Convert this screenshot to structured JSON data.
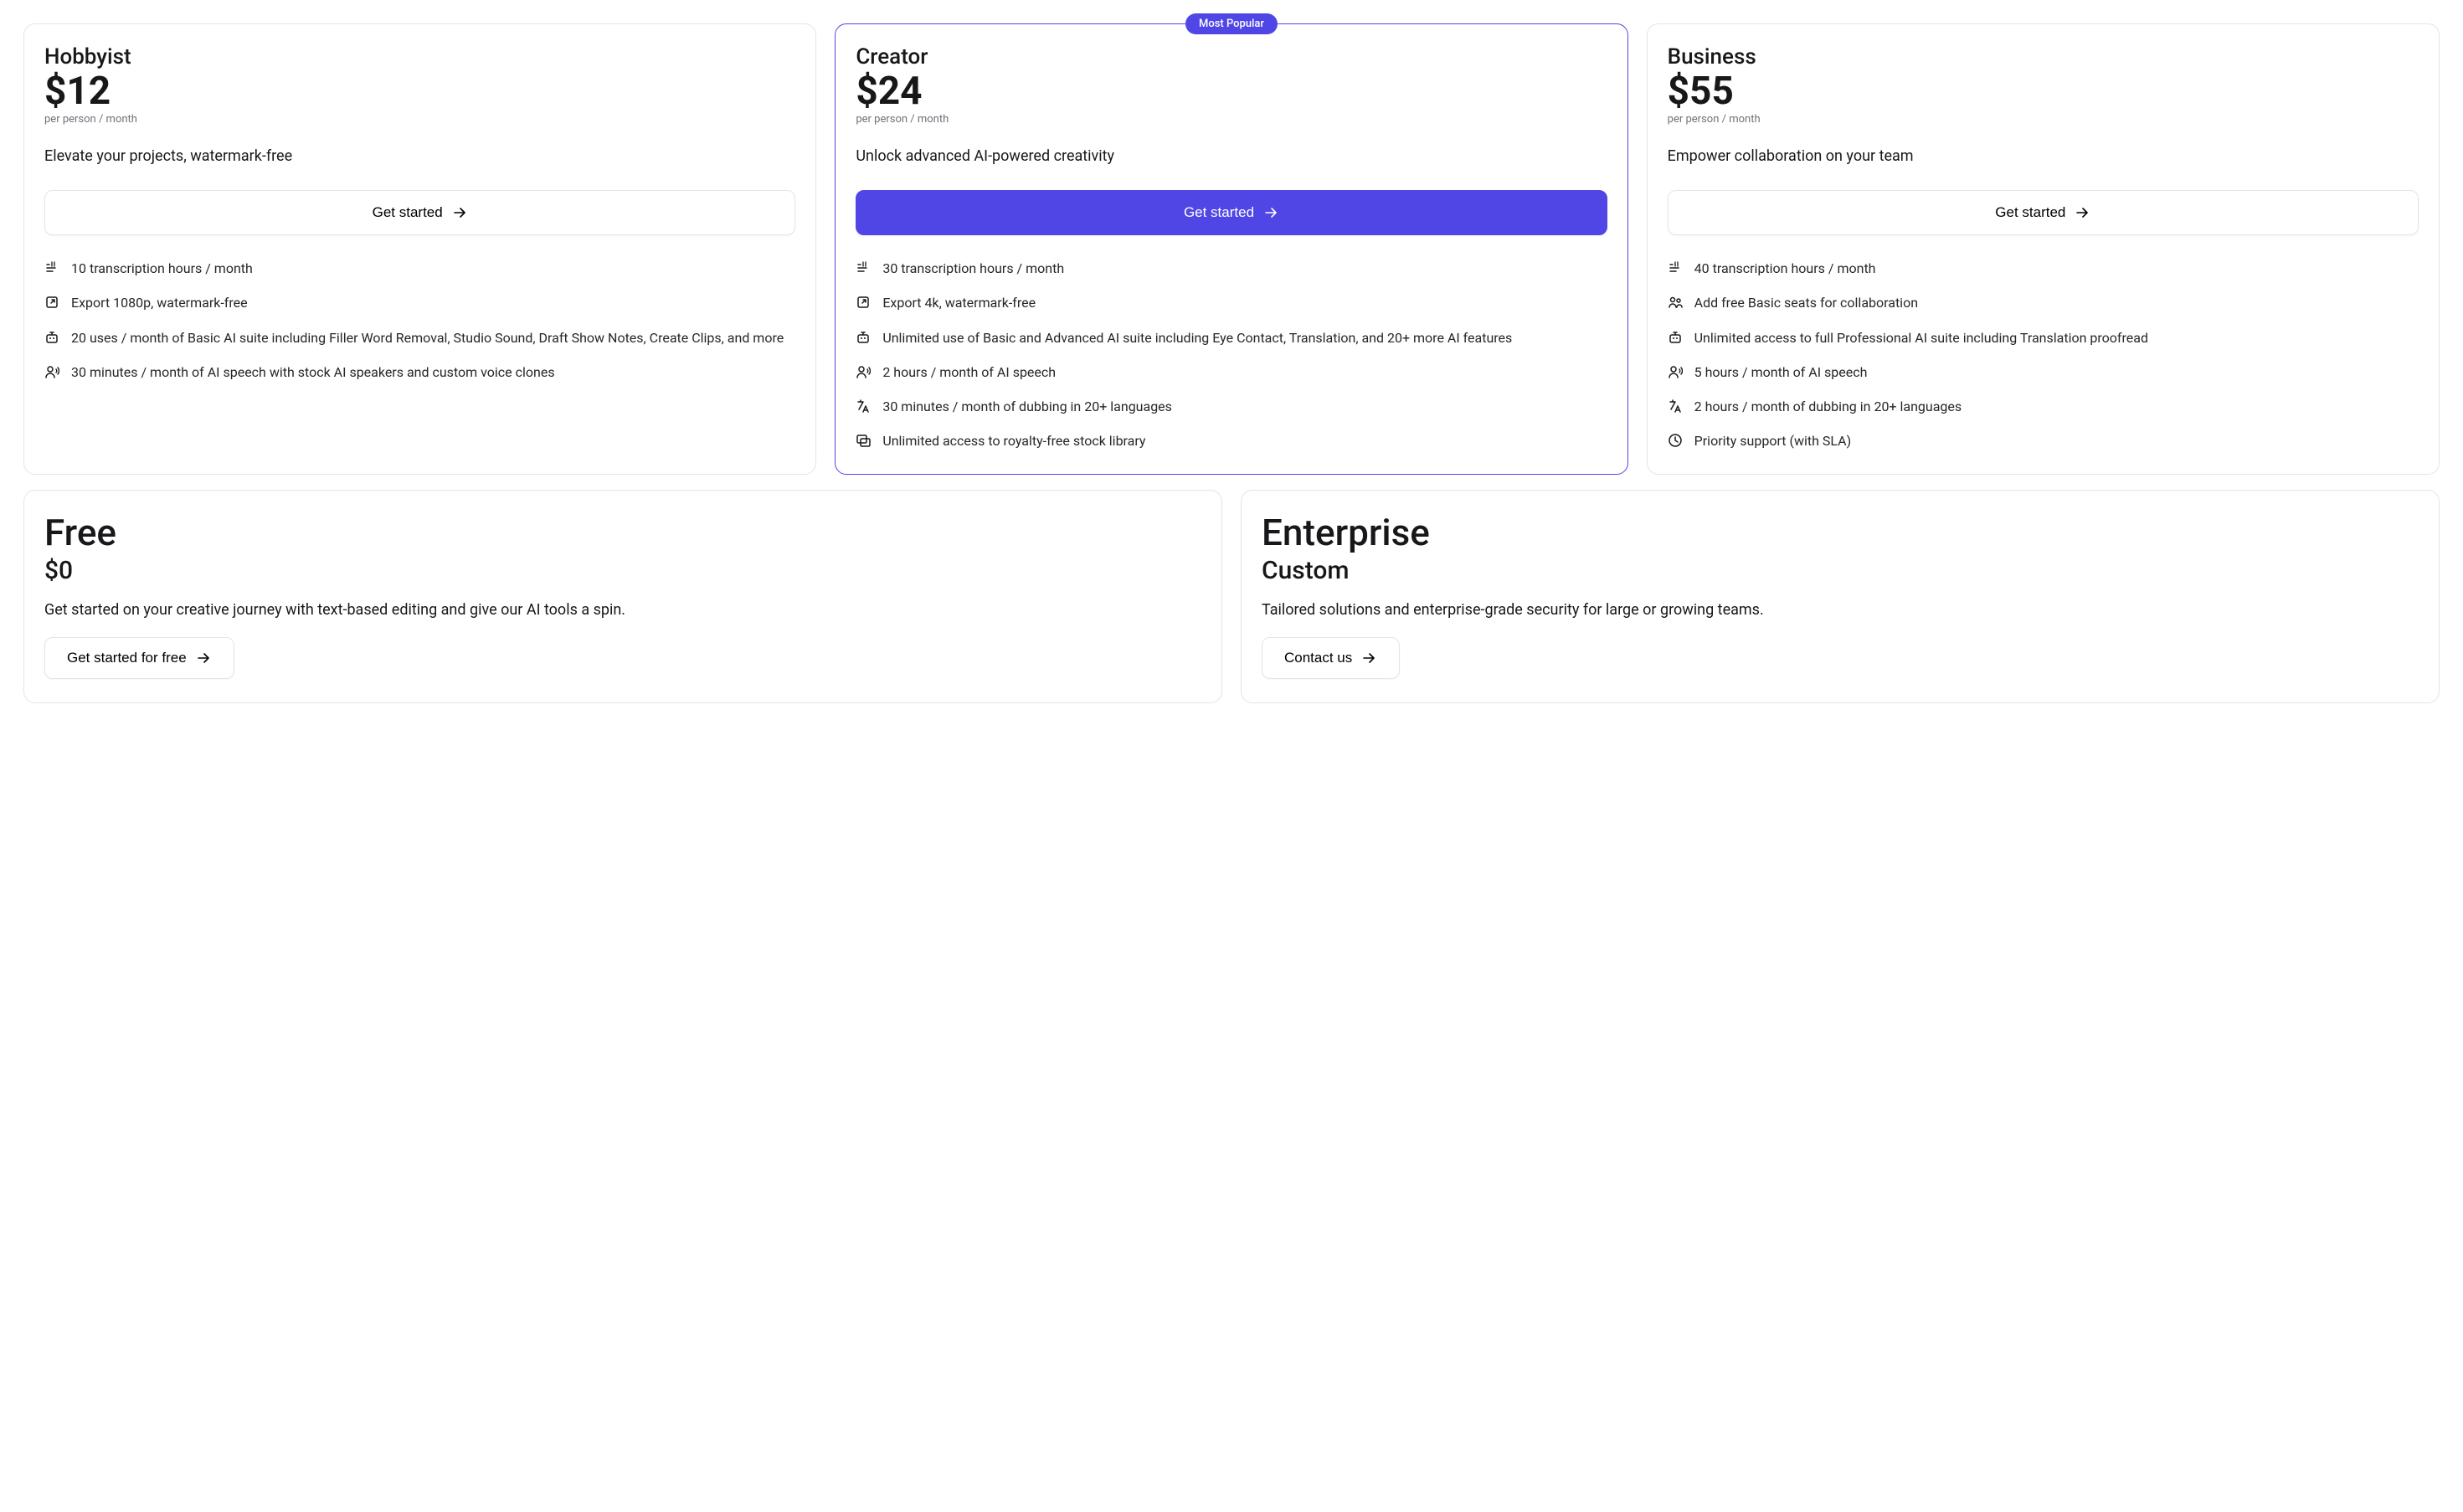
{
  "badge": "Most Popular",
  "plans": {
    "hobbyist": {
      "name": "Hobbyist",
      "price": "$12",
      "per": "per person / month",
      "tagline": "Elevate your projects, watermark-free",
      "cta": "Get started",
      "features": [
        {
          "icon": "transcription",
          "text": "10 transcription hours / month"
        },
        {
          "icon": "export",
          "text": "Export 1080p, watermark-free"
        },
        {
          "icon": "ai",
          "text": "20 uses / month of Basic AI suite including Filler Word Removal, Studio Sound, Draft Show Notes, Create Clips, and more"
        },
        {
          "icon": "speech",
          "text": "30 minutes / month of AI speech with stock AI speakers and custom voice clones"
        }
      ]
    },
    "creator": {
      "name": "Creator",
      "price": "$24",
      "per": "per person / month",
      "tagline": "Unlock advanced AI-powered creativity",
      "cta": "Get started",
      "features": [
        {
          "icon": "transcription",
          "text": "30 transcription hours / month"
        },
        {
          "icon": "export",
          "text": "Export 4k, watermark-free"
        },
        {
          "icon": "ai",
          "text": "Unlimited use of Basic and Advanced AI suite including Eye Contact, Translation, and 20+ more AI features"
        },
        {
          "icon": "speech",
          "text": "2 hours / month of AI speech"
        },
        {
          "icon": "dubbing",
          "text": "30 minutes / month of dubbing in 20+ languages"
        },
        {
          "icon": "stock",
          "text": "Unlimited access to royalty-free stock library"
        }
      ]
    },
    "business": {
      "name": "Business",
      "price": "$55",
      "per": "per person / month",
      "tagline": "Empower collaboration on your team",
      "cta": "Get started",
      "features": [
        {
          "icon": "transcription",
          "text": "40 transcription hours / month"
        },
        {
          "icon": "seats",
          "text": "Add free Basic seats for collaboration"
        },
        {
          "icon": "ai",
          "text": "Unlimited access to full Professional AI suite including Translation proofread"
        },
        {
          "icon": "speech",
          "text": "5 hours / month of AI speech"
        },
        {
          "icon": "dubbing",
          "text": "2 hours / month of dubbing in 20+ languages"
        },
        {
          "icon": "clock",
          "text": "Priority support (with SLA)"
        }
      ]
    },
    "free": {
      "name": "Free",
      "price": "$0",
      "tagline": "Get started on your creative journey with text-based editing and give our AI tools a spin.",
      "cta": "Get started for free"
    },
    "enterprise": {
      "name": "Enterprise",
      "price": "Custom",
      "tagline": "Tailored solutions and enterprise-grade security for large or growing teams.",
      "cta": "Contact us"
    }
  }
}
